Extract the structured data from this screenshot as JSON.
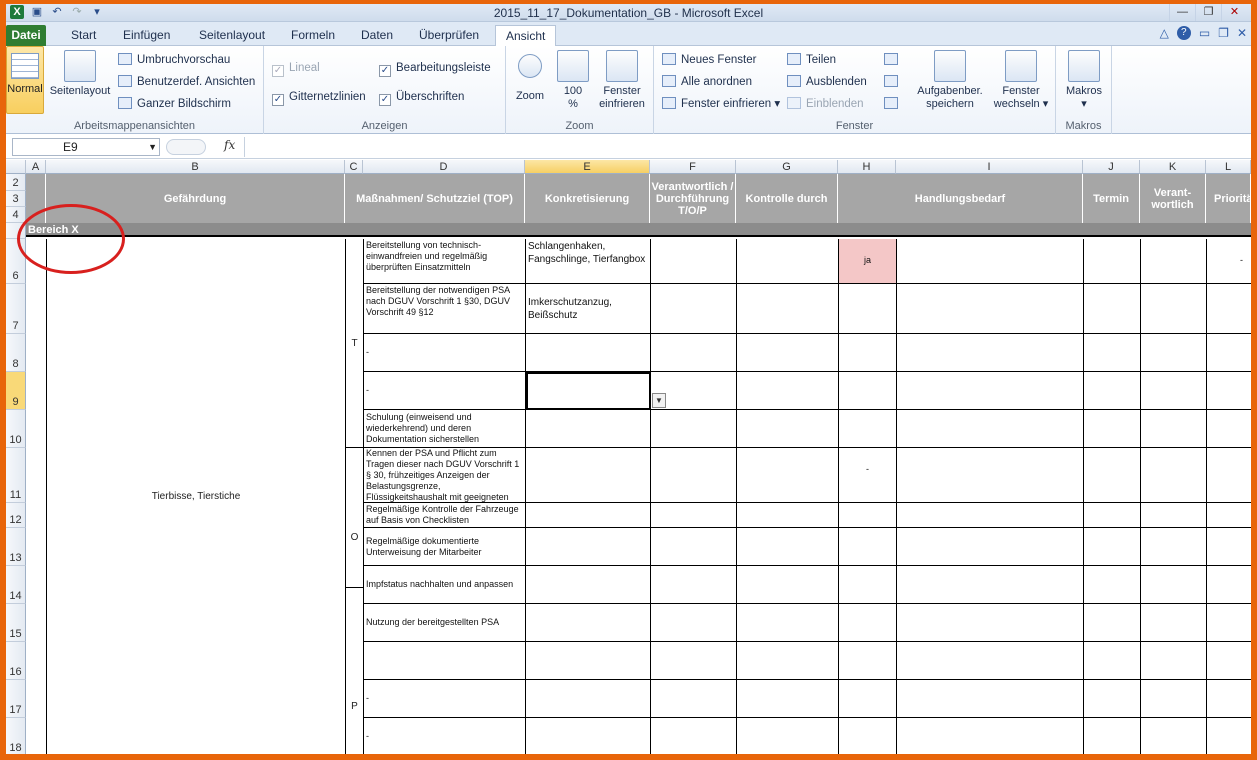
{
  "window": {
    "title": "2015_11_17_Dokumentation_GB - Microsoft Excel"
  },
  "tabs": [
    "Datei",
    "Start",
    "Einfügen",
    "Seitenlayout",
    "Formeln",
    "Daten",
    "Überprüfen",
    "Ansicht"
  ],
  "ribbon": {
    "arbeitsmappen": {
      "label": "Arbeitsmappenansichten",
      "normal": "Normal",
      "seitenlayout": "Seitenlayout",
      "umbruch": "Umbruchvorschau",
      "benutzer": "Benutzerdef. Ansichten",
      "ganzer": "Ganzer Bildschirm"
    },
    "anzeigen": {
      "label": "Anzeigen",
      "lineal": "Lineal",
      "gitter": "Gitternetzlinien",
      "bearbeitung": "Bearbeitungsleiste",
      "ueberschriften": "Überschriften"
    },
    "zoom": {
      "label": "Zoom",
      "zoom": "Zoom",
      "hundert_1": "100",
      "hundert_2": "%",
      "auswahl_1": "Fenster",
      "auswahl_2": "einfrieren"
    },
    "fenster": {
      "label": "Fenster",
      "neues": "Neues Fenster",
      "alle": "Alle anordnen",
      "einfrieren": "Fenster einfrieren",
      "teilen": "Teilen",
      "ausblenden": "Ausblenden",
      "einblenden": "Einblenden",
      "aufgaben_1": "Aufgabenber.",
      "aufgaben_2": "speichern",
      "wechseln_1": "Fenster",
      "wechseln_2": "wechseln"
    },
    "makros": {
      "label": "Makros",
      "makros": "Makros"
    }
  },
  "formula": {
    "namebox": "E9",
    "fx": "fx",
    "value": ""
  },
  "columns": [
    "A",
    "B",
    "C",
    "D",
    "E",
    "F",
    "G",
    "H",
    "I",
    "J",
    "K",
    "L"
  ],
  "rows": [
    "2",
    "3",
    "4",
    "6",
    "7",
    "8",
    "9",
    "10",
    "11",
    "12",
    "13",
    "14",
    "15",
    "16",
    "17",
    "18"
  ],
  "headers": {
    "B": "Gefährdung",
    "D": "Maßnahmen/ Schutzziel (TOP)",
    "E": "Konkretisierung",
    "F": "Verantwortlich / Durchführung T/O/P",
    "G": "Kontrolle durch",
    "H": "Handlungsbedarf",
    "J": "Termin",
    "K": "Verant-wortlich",
    "L": "Priorität"
  },
  "section": "Bereich X",
  "hazard": "Tierbisse, Tierstiche",
  "top_letters": {
    "t": "T",
    "o": "O",
    "p": "P"
  },
  "measures": [
    "Bereitstellung von technisch-einwandfreien und regelmäßig überprüften Einsatzmitteln",
    "Bereitstellung der notwendigen PSA nach DGUV Vorschrift 1 §30, DGUV Vorschrift 49 §12",
    "-",
    "-",
    "Schulung (einweisend und wiederkehrend) und deren Dokumentation sicherstellen",
    "Kennen der PSA und Pflicht zum Tragen dieser nach DGUV Vorschrift 1 § 30, frühzeitiges Anzeigen der Belastungsgrenze, Flüssigkeitshaushalt mit geeigneten",
    "Regelmäßige Kontrolle der Fahrzeuge auf Basis von Checklisten",
    "Regelmäßige dokumentierte Unterweisung der Mitarbeiter",
    "Impfstatus nachhalten und anpassen",
    "Nutzung der bereitgestellten PSA",
    "",
    "-",
    "-"
  ],
  "konkret": [
    "Schlangenhaken, Fangschlinge, Tierfangbox",
    "Imkerschutzanzug, Beißschutz"
  ],
  "bedarf": {
    "row6": "ja",
    "row11": "-"
  },
  "prio_row6": "-",
  "colors": {
    "accent_frame": "#e8650a",
    "header_gray": "#a6a6a6",
    "ja_fill": "#f4c7c7",
    "annotation_circle": "#d8201e"
  }
}
